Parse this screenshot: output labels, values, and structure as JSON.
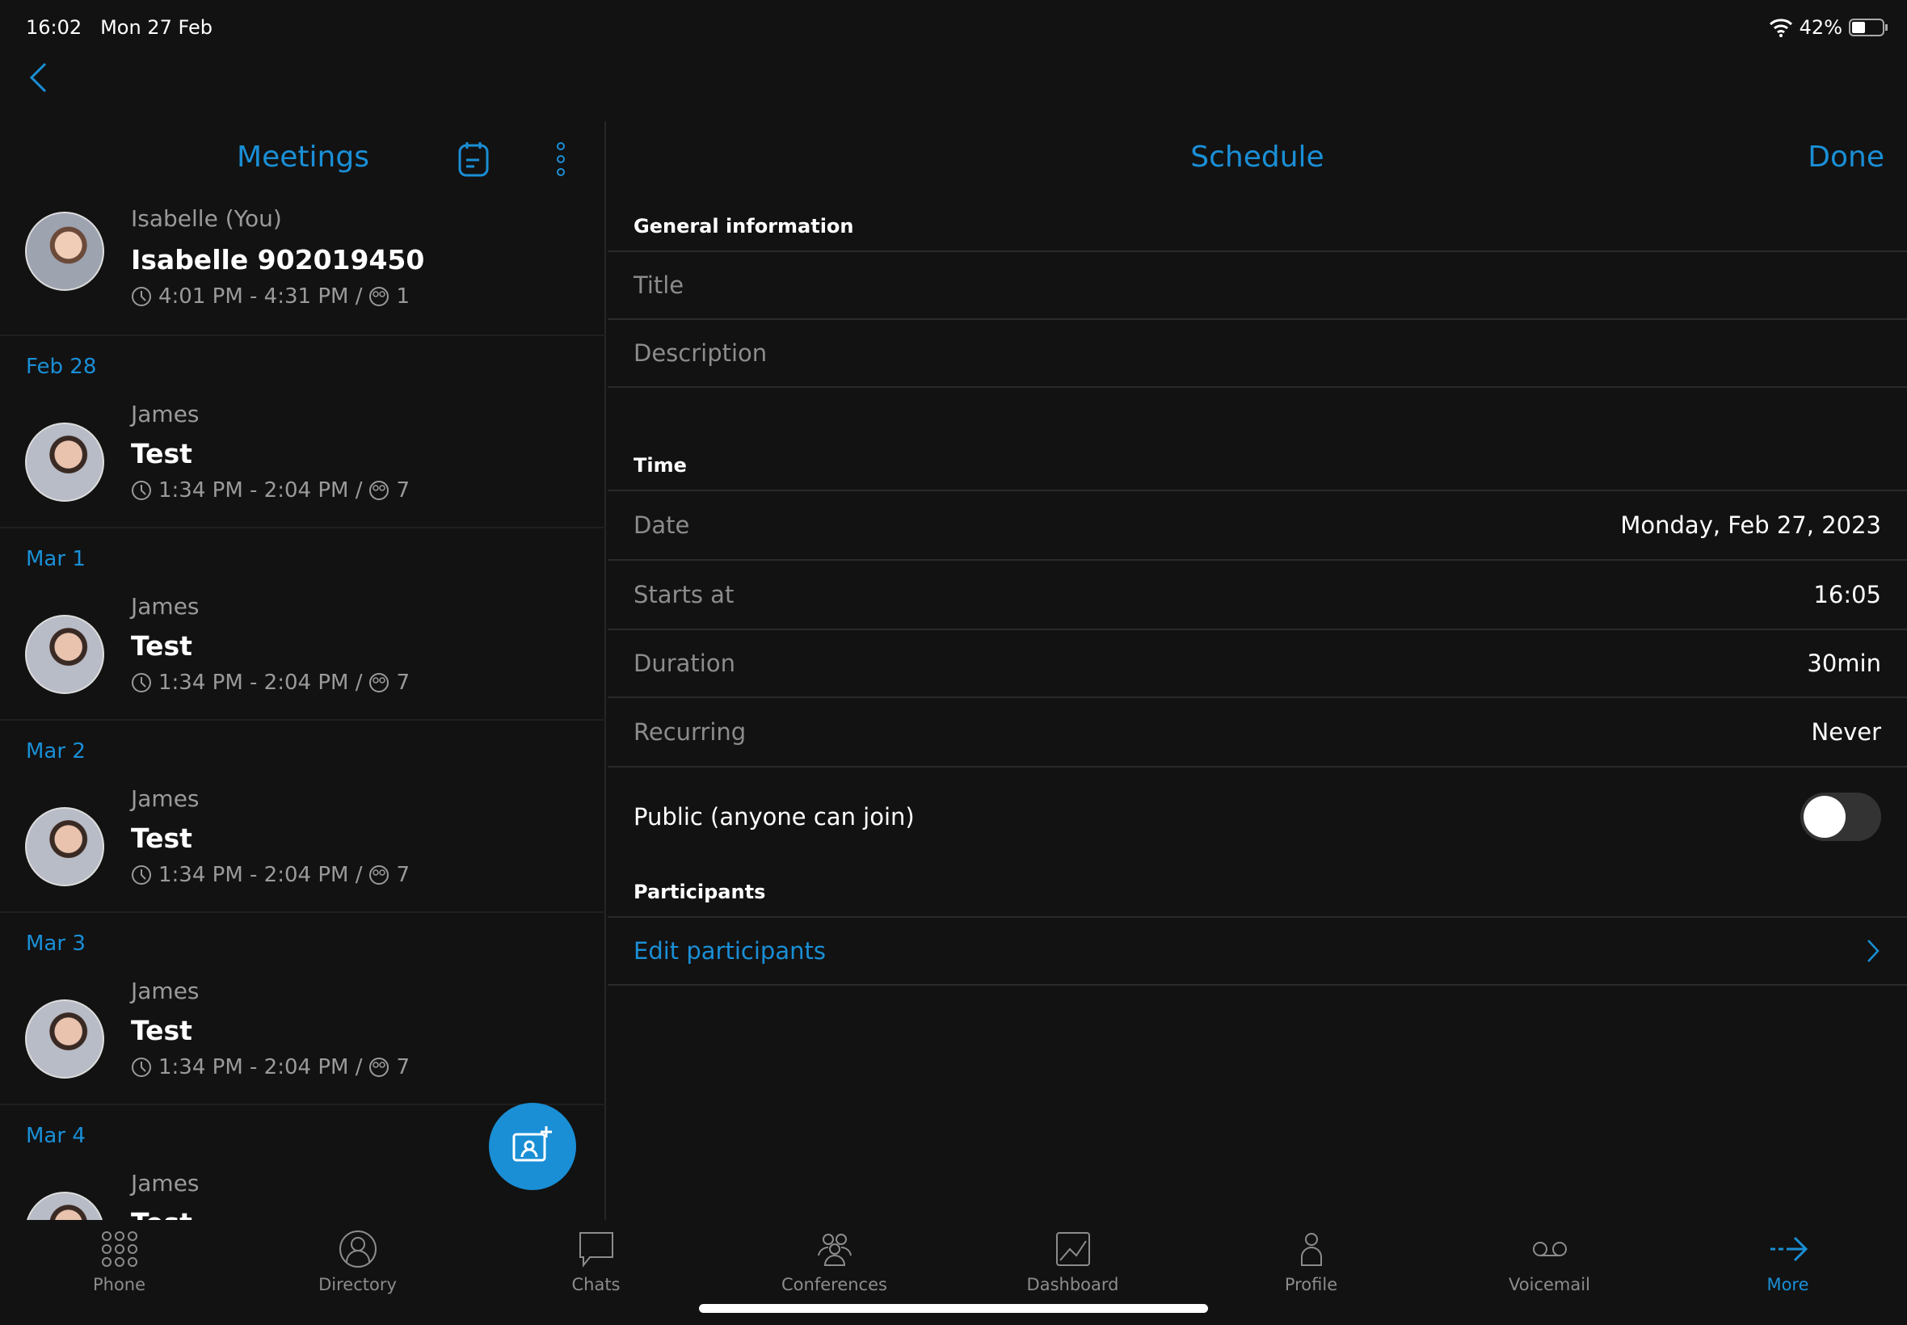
{
  "status": {
    "time": "16:02",
    "date": "Mon 27 Feb",
    "battery": "42%"
  },
  "meetings": {
    "title": "Meetings",
    "own": {
      "name": "Isabelle (You)",
      "title": "Isabelle 902019450",
      "time": "4:01 PM - 4:31 PM /",
      "participants": "1"
    },
    "groups": [
      {
        "date": "Feb 28",
        "name": "James",
        "title": "Test",
        "time": "1:34 PM - 2:04 PM /",
        "participants": "7"
      },
      {
        "date": "Mar 1",
        "name": "James",
        "title": "Test",
        "time": "1:34 PM - 2:04 PM /",
        "participants": "7"
      },
      {
        "date": "Mar 2",
        "name": "James",
        "title": "Test",
        "time": "1:34 PM - 2:04 PM /",
        "participants": "7"
      },
      {
        "date": "Mar 3",
        "name": "James",
        "title": "Test",
        "time": "1:34 PM - 2:04 PM /",
        "participants": "7"
      },
      {
        "date": "Mar 4",
        "name": "James",
        "title": "Test",
        "time": "",
        "participants": ""
      }
    ]
  },
  "schedule": {
    "title": "Schedule",
    "done": "Done",
    "general": "General information",
    "title_placeholder": "Title",
    "description_placeholder": "Description",
    "time": "Time",
    "date_label": "Date",
    "date_value": "Monday, Feb 27, 2023",
    "starts_label": "Starts at",
    "starts_value": "16:05",
    "duration_label": "Duration",
    "duration_value": "30min",
    "recurring_label": "Recurring",
    "recurring_value": "Never",
    "public_label": "Public (anyone can join)",
    "public_on": false,
    "participants": "Participants",
    "edit_participants": "Edit participants"
  },
  "tabs": [
    {
      "label": "Phone"
    },
    {
      "label": "Directory"
    },
    {
      "label": "Chats"
    },
    {
      "label": "Conferences"
    },
    {
      "label": "Dashboard"
    },
    {
      "label": "Profile"
    },
    {
      "label": "Voicemail"
    },
    {
      "label": "More",
      "active": true
    }
  ],
  "colors": {
    "accent": "#1a8fd6",
    "background": "#121212"
  }
}
